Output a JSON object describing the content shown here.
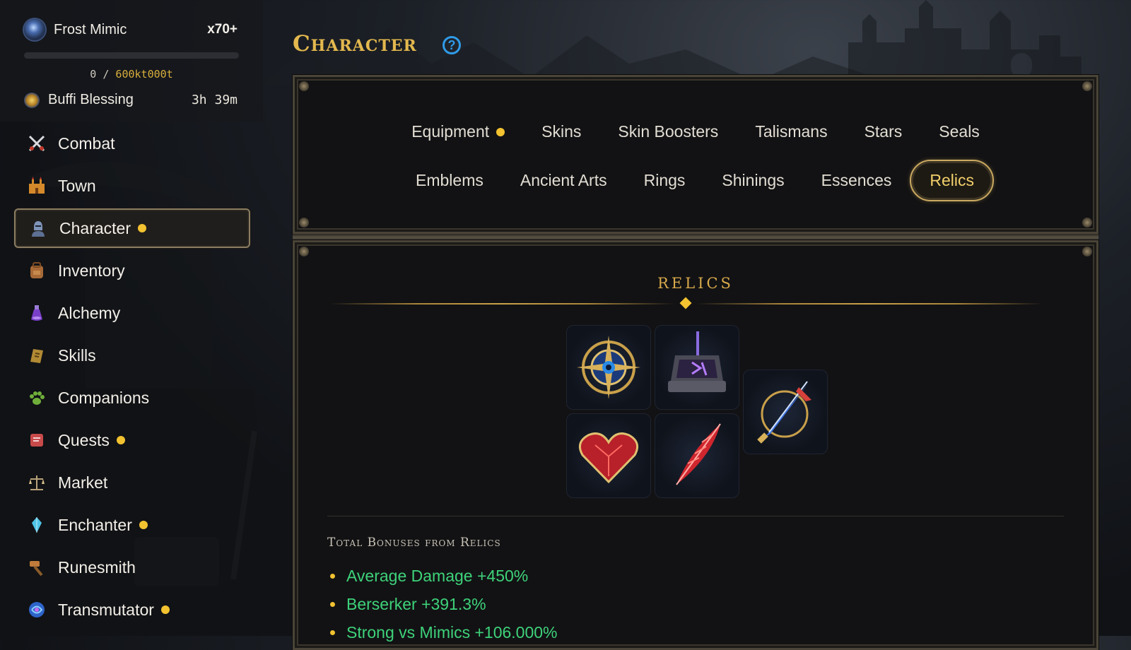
{
  "profile": {
    "name": "Frost Mimic",
    "multiplier": "x70+",
    "xp_current": "0",
    "xp_separator": "/",
    "xp_cap": "600kt000t",
    "xp_progress": 0,
    "buff_name": "Buffi Blessing",
    "buff_time": "3h 39m"
  },
  "sidebar": {
    "items": [
      {
        "label": "Combat",
        "icon": "crossed-swords-icon",
        "notify": false
      },
      {
        "label": "Town",
        "icon": "castle-icon",
        "notify": false
      },
      {
        "label": "Character",
        "icon": "knight-helmet-icon",
        "notify": true,
        "active": true
      },
      {
        "label": "Inventory",
        "icon": "backpack-icon",
        "notify": false
      },
      {
        "label": "Alchemy",
        "icon": "potion-icon",
        "notify": false
      },
      {
        "label": "Skills",
        "icon": "spellbook-icon",
        "notify": false
      },
      {
        "label": "Companions",
        "icon": "paw-icon",
        "notify": false
      },
      {
        "label": "Quests",
        "icon": "scroll-icon",
        "notify": true
      },
      {
        "label": "Market",
        "icon": "scales-icon",
        "notify": false
      },
      {
        "label": "Enchanter",
        "icon": "crystal-icon",
        "notify": true
      },
      {
        "label": "Runesmith",
        "icon": "hammer-icon",
        "notify": false
      },
      {
        "label": "Transmutator",
        "icon": "swirl-orb-icon",
        "notify": true
      }
    ]
  },
  "header": {
    "title": "Character",
    "help_glyph": "?"
  },
  "tabs": {
    "row1": [
      {
        "label": "Equipment",
        "notify": true
      },
      {
        "label": "Skins"
      },
      {
        "label": "Skin Boosters"
      },
      {
        "label": "Talismans"
      },
      {
        "label": "Stars"
      },
      {
        "label": "Seals"
      }
    ],
    "row2": [
      {
        "label": "Emblems"
      },
      {
        "label": "Ancient Arts"
      },
      {
        "label": "Rings"
      },
      {
        "label": "Shinings"
      },
      {
        "label": "Essences"
      },
      {
        "label": "Relics",
        "active": true
      }
    ]
  },
  "relics": {
    "section_title": "RELICS",
    "items": [
      {
        "name": "compass-relic-icon"
      },
      {
        "name": "rune-anvil-relic-icon"
      },
      {
        "name": "dragon-sword-relic-icon"
      },
      {
        "name": "crystal-heart-relic-icon"
      },
      {
        "name": "crimson-feather-relic-icon"
      }
    ],
    "bonus_title": "Total Bonuses from Relics",
    "bonuses": [
      "Average Damage +450%",
      "Berserker +391.3%",
      "Strong vs Mimics +106.000%"
    ]
  },
  "colors": {
    "accent_gold": "#e3b84e",
    "notify_dot": "#f2c230",
    "bonus_green": "#3ed27a",
    "help_blue": "#2f9be8"
  }
}
